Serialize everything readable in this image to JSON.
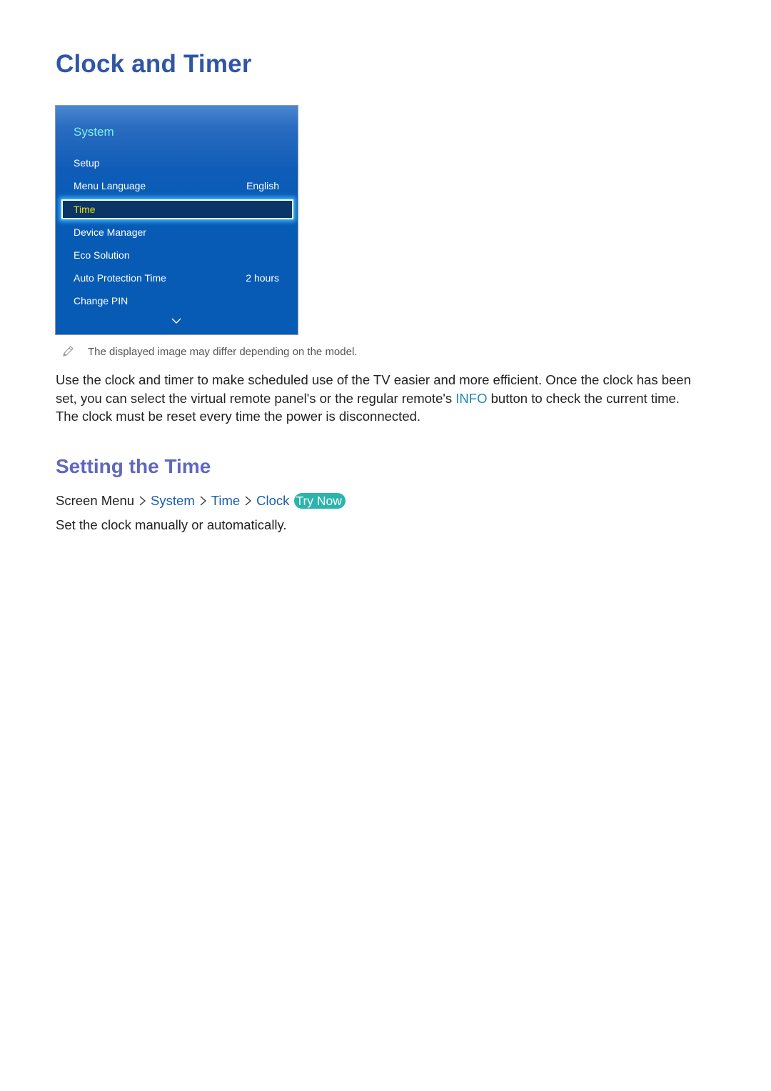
{
  "page": {
    "title": "Clock and Timer"
  },
  "tv_menu": {
    "header": "System",
    "items": [
      {
        "label": "Setup",
        "value": ""
      },
      {
        "label": "Menu Language",
        "value": "English"
      },
      {
        "label": "Time",
        "value": "",
        "selected": true
      },
      {
        "label": "Device Manager",
        "value": ""
      },
      {
        "label": "Eco Solution",
        "value": ""
      },
      {
        "label": "Auto Protection Time",
        "value": "2 hours"
      },
      {
        "label": "Change PIN",
        "value": ""
      }
    ],
    "scroll_icon": "chevron-down-icon"
  },
  "note": {
    "icon": "pencil-icon",
    "text": "The displayed image may differ depending on the model."
  },
  "intro": {
    "part1": "Use the clock and timer to make scheduled use of the TV easier and more efficient. Once the clock has been set, you can select the virtual remote panel's or the regular remote's ",
    "highlight": "INFO",
    "part2": " button to check the current time. The clock must be reset every time the power is disconnected."
  },
  "section": {
    "title": "Setting the Time",
    "breadcrumb": [
      "Screen Menu",
      "System",
      "Time",
      "Clock"
    ],
    "try_now": "Try Now",
    "description": "Set the clock manually or automatically."
  },
  "colors": {
    "title": "#2f55a4",
    "section_title": "#6067bf",
    "link": "#1a5fa8",
    "info": "#1e88b4",
    "try_now_bg": "#2bb4ac",
    "menu_bg": "#075bb5",
    "menu_selected_text": "#f4e000",
    "menu_header_text": "#7ef0e6"
  }
}
